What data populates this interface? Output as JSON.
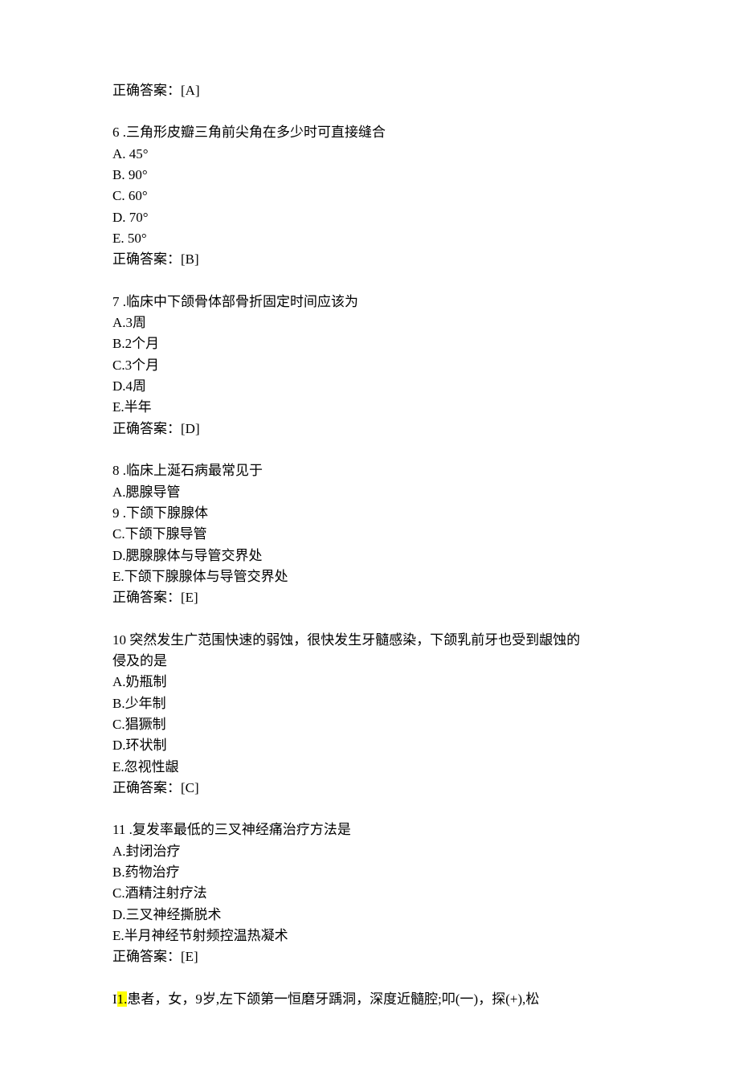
{
  "answer5": "正确答案：[A]",
  "q6": {
    "stem": "6 .三角形皮瓣三角前尖角在多少时可直接缝合",
    "A": "A. 45°",
    "B": "B. 90°",
    "C": "C. 60°",
    "D": "D. 70°",
    "E": "E. 50°",
    "answer": "正确答案：[B]"
  },
  "q7": {
    "stem": "7 .临床中下颌骨体部骨折固定时间应该为",
    "A": "A.3周",
    "B": "B.2个月",
    "C": "C.3个月",
    "D": "D.4周",
    "E": "E.半年",
    "answer": "正确答案：[D]"
  },
  "q8": {
    "stem": "8 .临床上涎石病最常见于",
    "A": "A.腮腺导管",
    "B": "9 .下颌下腺腺体",
    "C": "C.下颌下腺导管",
    "D": "D.腮腺腺体与导管交界处",
    "E": "E.下颌下腺腺体与导管交界处",
    "answer": "正确答案：[E]"
  },
  "q10": {
    "stem1": "10 突然发生广范围快速的弱蚀，很快发生牙髓感染，下颌乳前牙也受到龈蚀的",
    "stem2": "侵及的是",
    "A": "A.奶瓶制",
    "B": "B.少年制",
    "C": "C.猖獗制",
    "D": "D.环状制",
    "E": "E.忽视性龈",
    "answer": "正确答案：[C]"
  },
  "q11": {
    "stem": "11 .复发率最低的三叉神经痛治疗方法是",
    "A": "A.封闭治疗",
    "B": "B.药物治疗",
    "C": "C.酒精注射疗法",
    "D": "D.三叉神经撕脱术",
    "E": "E.半月神经节射频控温热凝术",
    "answer": "正确答案：[E]"
  },
  "q12": {
    "prefix": "I",
    "hl": "1.",
    "rest": "患者，女，9岁,左下颌第一恒磨牙踽洞，深度近髓腔;叩(一)，探(+),松"
  }
}
